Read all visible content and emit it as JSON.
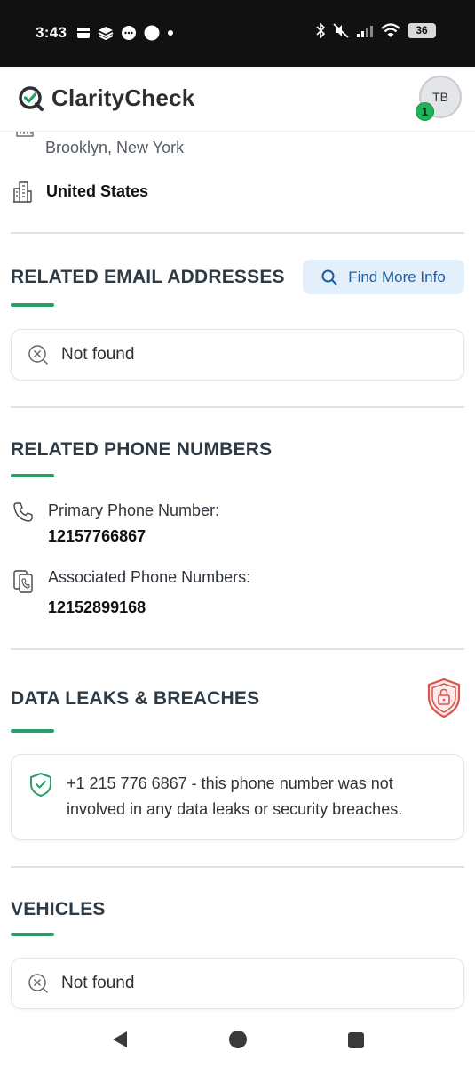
{
  "status_bar": {
    "time": "3:43",
    "battery": "36"
  },
  "header": {
    "logo_text": "ClarityCheck",
    "avatar_initials": "TB",
    "badge_count": "1"
  },
  "location": {
    "city": "Brooklyn, New York",
    "country": "United States"
  },
  "email_section": {
    "title": "RELATED EMAIL ADDRESSES",
    "find_more_label": "Find More Info",
    "result": "Not found"
  },
  "phone_section": {
    "title": "RELATED PHONE NUMBERS",
    "primary_label": "Primary Phone Number:",
    "primary_value": "12157766867",
    "associated_label": "Associated Phone Numbers:",
    "associated_value": "12152899168"
  },
  "breach_section": {
    "title": "DATA LEAKS & BREACHES",
    "message": "+1 215 776 6867 - this phone number was not involved in any data leaks or security breaches."
  },
  "vehicles_section": {
    "title": "VEHICLES",
    "result": "Not found"
  },
  "colors": {
    "accent": "#2a9d6a",
    "button_bg": "#e3effb",
    "button_text": "#1f5fa0",
    "danger": "#d9534f"
  }
}
